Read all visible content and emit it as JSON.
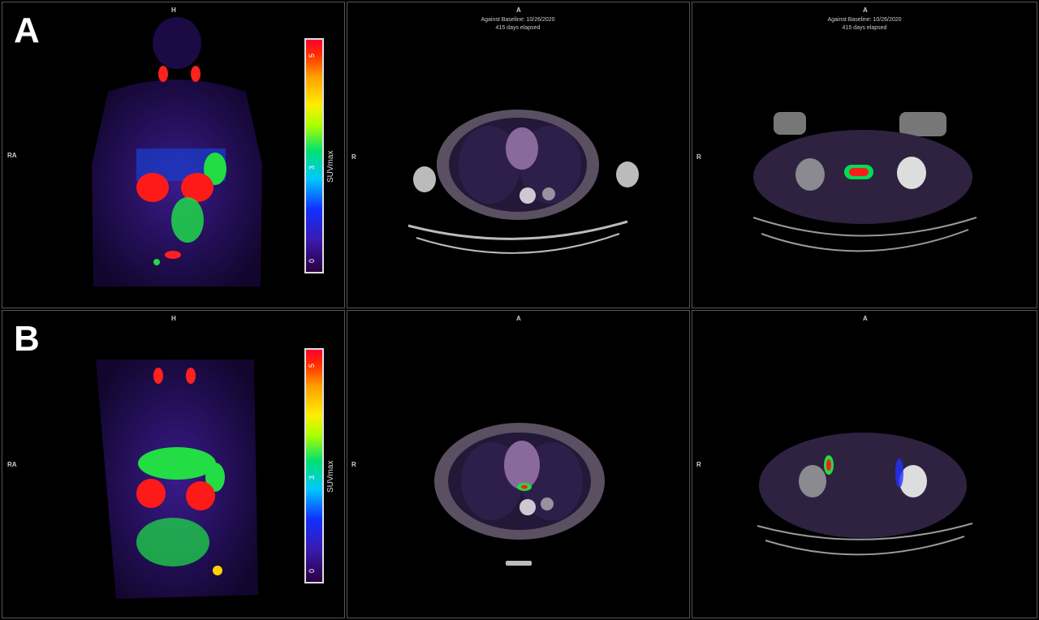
{
  "rows": [
    {
      "letter": "A",
      "mip": {
        "top_label": "H",
        "side_label": "RA"
      },
      "scale": {
        "title": "SUVmax",
        "ticks": [
          "5",
          "3",
          "0"
        ]
      },
      "thorax": {
        "top_label": "A",
        "side_label": "R",
        "annotation_line1": "Against Baseline: 10/26/2020",
        "annotation_line2": "415 days elapsed"
      },
      "pelvis": {
        "top_label": "A",
        "side_label": "R",
        "annotation_line1": "Against Baseline: 10/26/2020",
        "annotation_line2": "415 days elapsed"
      }
    },
    {
      "letter": "B",
      "mip": {
        "top_label": "H",
        "side_label": "RA"
      },
      "scale": {
        "title": "SUVmax",
        "ticks": [
          "5",
          "3",
          "0"
        ]
      },
      "thorax": {
        "top_label": "A",
        "side_label": "R"
      },
      "pelvis": {
        "top_label": "A",
        "side_label": "R"
      }
    }
  ]
}
